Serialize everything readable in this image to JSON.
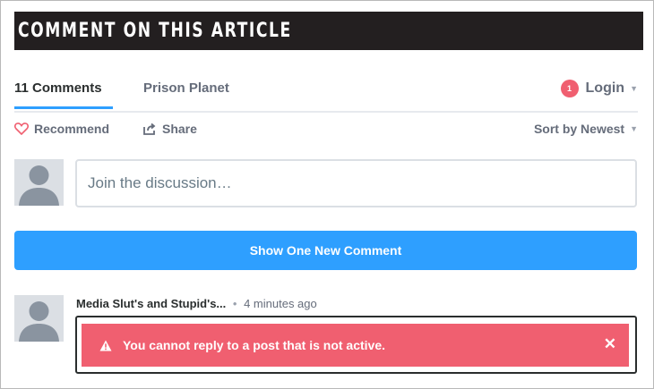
{
  "section": {
    "title": "COMMENT ON THIS ARTICLE"
  },
  "nav": {
    "comments_tab": "11 Comments",
    "community_tab": "Prison Planet",
    "notification_count": "1",
    "login_label": "Login"
  },
  "actions": {
    "recommend_label": "Recommend",
    "share_label": "Share",
    "sort_label": "Sort by Newest"
  },
  "composer": {
    "placeholder": "Join the discussion…"
  },
  "new_comments": {
    "label": "Show One New Comment"
  },
  "comment": {
    "author": "Media Slut's and Stupid's...",
    "separator": "•",
    "time": "4 minutes ago"
  },
  "alert": {
    "message": "You cannot reply to a post that is not active.",
    "close": "✕"
  },
  "colors": {
    "accent": "#2e9fff",
    "alert": "#f05f70",
    "banner": "#231f20"
  }
}
